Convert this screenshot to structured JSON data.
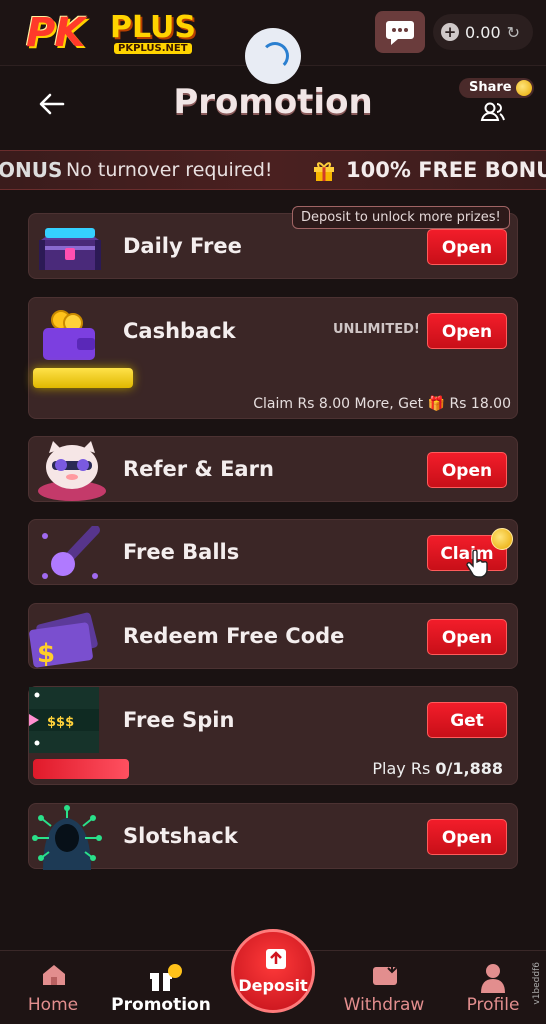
{
  "app": {
    "logo_main": "PK",
    "logo_plus": "PLUS",
    "logo_domain": "PKPLUS.NET"
  },
  "topbar": {
    "balance": "0.00"
  },
  "header": {
    "title": "Promotion",
    "share_label": "Share"
  },
  "ticker": {
    "text_left": "ONUS",
    "text_mid": "No turnover required!",
    "text_right": "100% FREE BONUS"
  },
  "promotions": {
    "tooltip": "Deposit to unlock more prizes!",
    "daily_free": {
      "label": "Daily Free",
      "button": "Open"
    },
    "cashback": {
      "label": "Cashback",
      "badge": "UNLIMITED!",
      "button": "Open",
      "note_prefix": "Claim Rs 8.00 More, Get",
      "note_suffix": "Rs 18.00",
      "progress": 0.22
    },
    "refer": {
      "label": "Refer & Earn",
      "button": "Open"
    },
    "free_balls": {
      "label": "Free Balls",
      "button": "Claim"
    },
    "redeem": {
      "label": "Redeem Free Code",
      "button": "Open"
    },
    "free_spin": {
      "label": "Free Spin",
      "button": "Get",
      "reel_text": "$$$",
      "note_prefix": "Play Rs ",
      "note_value": "0/1,888",
      "progress": 0.05
    },
    "slotshack": {
      "label": "Slotshack",
      "button": "Open"
    }
  },
  "nav": {
    "home": "Home",
    "promotion": "Promotion",
    "deposit": "Deposit",
    "withdraw": "Withdraw",
    "profile": "Profile"
  },
  "version": "v1beddf6",
  "colors": {
    "accent_red": "#e4141f",
    "card_bg": "#3b2626",
    "nav_inactive": "#e28e8e"
  }
}
